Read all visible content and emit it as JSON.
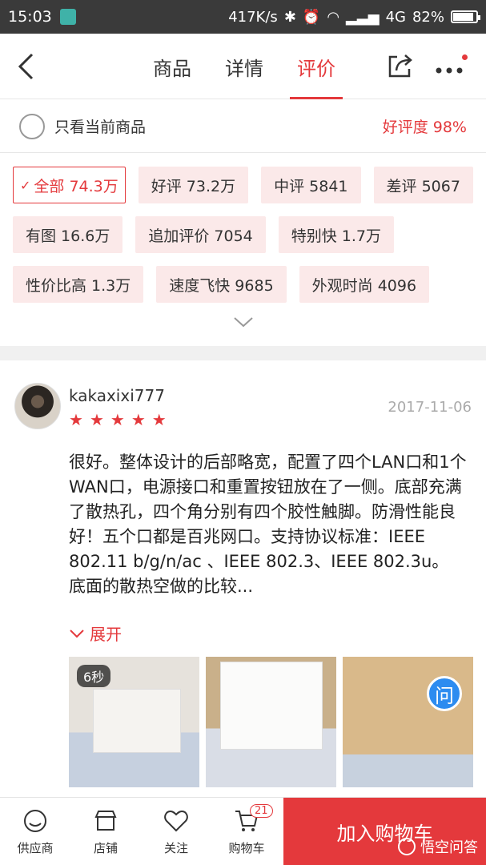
{
  "status_bar": {
    "time": "15:03",
    "network_speed": "417K/s",
    "signal_type": "4G",
    "battery": "82%"
  },
  "nav": {
    "tabs": [
      {
        "label": "商品",
        "active": false
      },
      {
        "label": "详情",
        "active": false
      },
      {
        "label": "评价",
        "active": true
      }
    ]
  },
  "filter": {
    "only_current_label": "只看当前商品",
    "good_rate": "好评度 98%"
  },
  "tags": [
    {
      "label": "全部 74.3万",
      "active": true
    },
    {
      "label": "好评 73.2万"
    },
    {
      "label": "中评 5841"
    },
    {
      "label": "差评 5067"
    },
    {
      "label": "有图 16.6万"
    },
    {
      "label": "追加评价 7054"
    },
    {
      "label": "特别快 1.7万"
    },
    {
      "label": "性价比高 1.3万"
    },
    {
      "label": "速度飞快 9685"
    },
    {
      "label": "外观时尚 4096"
    }
  ],
  "review": {
    "username": "kakaxixi777",
    "date": "2017-11-06",
    "rating": 5,
    "content": "很好。整体设计的后部略宽，配置了四个LAN口和1个WAN口，电源接口和重置按钮放在了一侧。底部充满了散热孔，四个角分别有四个胶性触脚。防滑性能良好！五个口都是百兆网口。支持协议标准：IEEE 802.11 b/g/n/ac 、IEEE 802.3、IEEE 802.3u。 底面的散热空做的比较...",
    "unfold_label": "展开",
    "video_duration": "6秒",
    "badge_text": "问"
  },
  "bottom_bar": {
    "items": [
      {
        "label": "供应商",
        "icon": "supplier-icon"
      },
      {
        "label": "店铺",
        "icon": "shop-icon"
      },
      {
        "label": "关注",
        "icon": "heart-icon"
      },
      {
        "label": "购物车",
        "icon": "cart-icon",
        "count": "21"
      }
    ],
    "add_to_cart": "加入购物车",
    "watermark": "悟空问答"
  },
  "colors": {
    "accent": "#e4393c",
    "tag_bg": "#fbe9e9",
    "status_bar": "#3a3a3a"
  }
}
